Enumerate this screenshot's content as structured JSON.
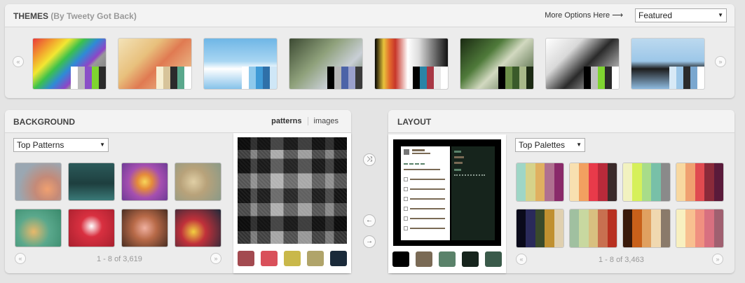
{
  "themes": {
    "title": "THEMES",
    "subtitle": "(By Tweety Got Back)",
    "more_options": "More Options Here ⟶",
    "select_value": "Featured",
    "prev_icon": "«",
    "next_icon": "»",
    "items": [
      {
        "bg": "linear-gradient(135deg,#e93a3a 0%,#f2a12e 18%,#f2e732 30%,#3cc24b 42%,#2f8ad6 54%,#8f44c7 66%,#9a9a9a 70%,#6a6a6a 100%)",
        "swatches": [
          "#ffffff",
          "#bcbcbc",
          "#8a4fc7",
          "#7fd430",
          "#2a2a2a"
        ]
      },
      {
        "bg": "linear-gradient(135deg,#f3e3b9 0%,#e8c07c 35%,#e07a52 55%,#f0d7a0 100%)",
        "swatches": [
          "#f7efd2",
          "#d7c49a",
          "#2b2b2b",
          "#5aa88c",
          "#ffffff"
        ]
      },
      {
        "bg": "linear-gradient(180deg,#6fb6e6 0%,#a8d6f2 45%,#ffffff 60%,#86c2ea 100%)",
        "swatches": [
          "#ffffff",
          "#8ec9ec",
          "#3f9ad6",
          "#2f70a8",
          "#cfe7f7"
        ]
      },
      {
        "bg": "linear-gradient(135deg,#3c4a33 0%,#8ea07a 40%,#c9cfd6 70%,#5a6e4a 100%)",
        "swatches": [
          "#000000",
          "#b7b7b7",
          "#4c63a8",
          "#9aa0cc",
          "#3a3a3a"
        ]
      },
      {
        "bg": "linear-gradient(90deg,#000000 0%,#e8c43c 12%,#e36b2d 20%,#c7362a 28%,#ffffff 45%,#dddddd 60%,#111111 100%)",
        "swatches": [
          "#000000",
          "#2a84a6",
          "#a83744",
          "#e8e8e8",
          "#ffffff"
        ]
      },
      {
        "bg": "linear-gradient(135deg,#1a2a12 0%,#4f7a3a 35%,#d2d9c0 55%,#2e4a22 100%)",
        "swatches": [
          "#000000",
          "#6d8f4a",
          "#3a5a2a",
          "#a9b98a",
          "#1c2a14"
        ]
      },
      {
        "bg": "linear-gradient(135deg,#ffffff 0%,#d9d9d9 30%,#2a2a2a 55%,#ffffff 100%)",
        "swatches": [
          "#000000",
          "#bfbfbf",
          "#7fd430",
          "#2a2a2a",
          "#ffffff"
        ]
      },
      {
        "bg": "linear-gradient(180deg,#bcd9ef 0%,#9cc7e8 45%,#1d1d1d 60%,#8fbbe0 100%)",
        "swatches": [
          "#d7e9f6",
          "#9cc7e8",
          "#2b2b2b",
          "#7aa7cf",
          "#ffffff"
        ]
      }
    ]
  },
  "background": {
    "title": "BACKGROUND",
    "tab_patterns": "patterns",
    "tab_images": "images",
    "select_value": "Top Patterns",
    "pager_text": "1 - 8 of 3,619",
    "prev_icon": "«",
    "next_icon": "»",
    "tiles": [
      "radial-gradient(circle at 70% 70%,#f0a070 0%,#c48a78 30%,#9aa7b2 70%)",
      "linear-gradient(180deg,#2b5a5a 0%,#1e3f3f 55%,#3a7a78 100%)",
      "radial-gradient(circle at 50% 50%,#f7d65a 0%,#e58b3a 25%,#a54fb0 55%,#6e3b96 100%)",
      "radial-gradient(circle at 40% 50%,#e0cfa5 0%,#b8a27a 40%,#8a9a88 100%)",
      "radial-gradient(circle at 40% 60%,#e8b86a 0%,#5aa88c 45%,#3a8a6c 100%)",
      "radial-gradient(circle at 50% 45%,#ffffff 0%,#d93040 35%,#a8202e 100%)",
      "radial-gradient(circle at 50% 50%,#f0b0a0 0%,#b86a48 40%,#4a2e22 100%)",
      "radial-gradient(circle at 40% 60%,#f2d040 0%,#c0303a 35%,#1e2a3a 100%)"
    ],
    "preview_colors": [
      "#a34a50",
      "#d9505a",
      "#c9b84a",
      "#b0a46a",
      "#1a2a3a"
    ]
  },
  "controls": {
    "shuffle_icon": "⤨",
    "left_icon": "←",
    "right_icon": "→"
  },
  "layout": {
    "title": "LAYOUT",
    "select_value": "Top Palettes",
    "pager_text": "1 - 8 of 3,463",
    "prev_icon": "«",
    "next_icon": "»",
    "preview_colors": [
      "#000000",
      "#7a6a55",
      "#5a826a",
      "#16241c",
      "#3a5a4a"
    ],
    "palettes": [
      [
        "#9fd6c6",
        "#d6d28a",
        "#e0b060",
        "#b07090",
        "#8a2a6a"
      ],
      [
        "#f8e0b0",
        "#f2a060",
        "#e83a4a",
        "#b82a3a",
        "#3a2a2a"
      ],
      [
        "#f2f2c0",
        "#d6f05a",
        "#a8dc8a",
        "#78c0a8",
        "#8a8a8a"
      ],
      [
        "#f8d8a0",
        "#f0a070",
        "#e04a50",
        "#8a2a3a",
        "#5a1a3a"
      ],
      [
        "#0a0a1a",
        "#2a2a5a",
        "#3a4a2a",
        "#c09030",
        "#e0d0b0"
      ],
      [
        "#a0c0a0",
        "#c8d8a0",
        "#d8c080",
        "#c87050",
        "#b83020"
      ],
      [
        "#3a1a0a",
        "#c8601a",
        "#e0a060",
        "#f0d8b0",
        "#8a7a6a"
      ],
      [
        "#f8f0c0",
        "#f8c090",
        "#f09080",
        "#d87080",
        "#a06070"
      ]
    ]
  }
}
